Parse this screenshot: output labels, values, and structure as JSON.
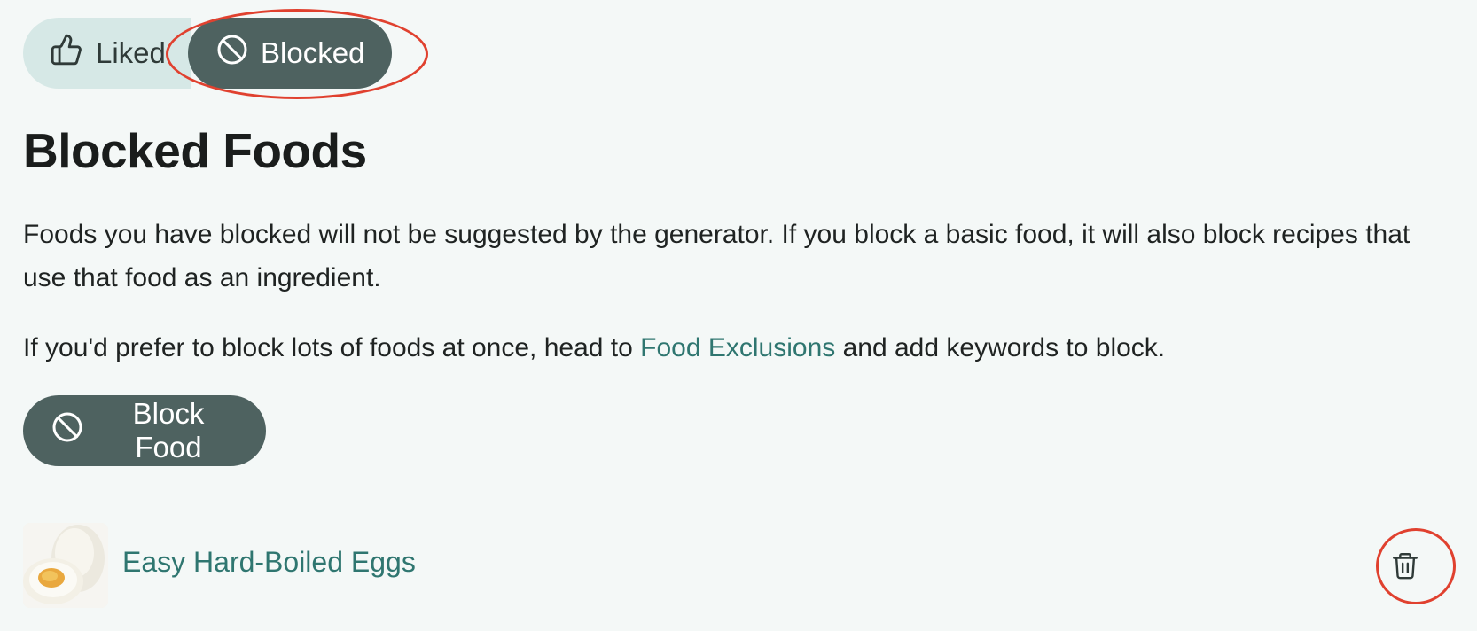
{
  "toggle": {
    "liked_label": "Liked",
    "blocked_label": "Blocked",
    "selected": "Blocked",
    "liked_icon": "thumbs-up-icon",
    "blocked_icon": "block-icon"
  },
  "page": {
    "title": "Blocked Foods",
    "description": "Foods you have blocked will not be suggested by the generator. If you block a basic food, it will also block recipes that use that food as an ingredient.",
    "exclusions_before": "If you'd prefer to block lots of foods at once, head to ",
    "exclusions_link": "Food Exclusions",
    "exclusions_after": " and add keywords to block."
  },
  "actions": {
    "block_food_label": "Block Food",
    "block_food_icon": "block-icon"
  },
  "blocked_foods": [
    {
      "name": "Easy Hard-Boiled Eggs",
      "thumbnail": "hard-boiled-eggs-image",
      "delete_icon": "trash-icon"
    }
  ],
  "colors": {
    "background": "#f4f8f7",
    "primary_button": "#4e6260",
    "toggle_inactive": "#d6e8e6",
    "link": "#2f7670",
    "annotation": "#e0412f"
  }
}
